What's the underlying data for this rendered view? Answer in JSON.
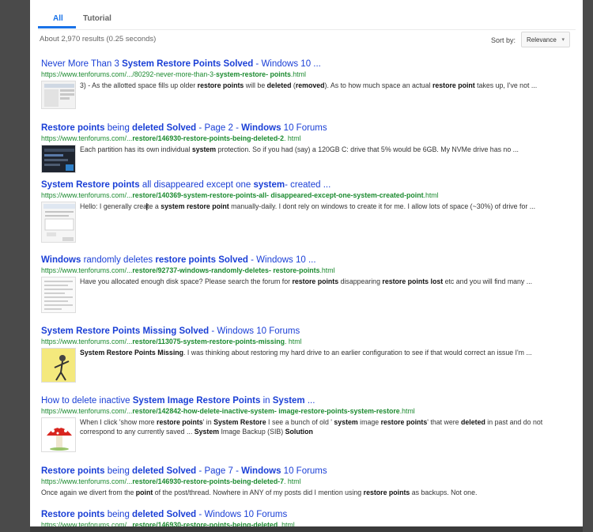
{
  "tabs": [
    {
      "label": "All",
      "active": true
    },
    {
      "label": "Tutorial",
      "active": false
    }
  ],
  "stats": "About 2,970 results (0.25 seconds)",
  "sort": {
    "label": "Sort by:",
    "value": "Relevance"
  },
  "results": [
    {
      "title_parts": [
        [
          "Never More Than 3 ",
          false
        ],
        [
          "System Restore Points Solved",
          true
        ],
        [
          " - Windows 10 ...",
          false
        ]
      ],
      "url_parts": [
        [
          "https://www.tenforums.com/.../80292-never-more-than-3-",
          false
        ],
        [
          "system-restore- points",
          true
        ],
        [
          ".html",
          false
        ]
      ],
      "snippet_parts": [
        [
          "3) - As the allotted space fills up older ",
          false
        ],
        [
          "restore points",
          true
        ],
        [
          " will be ",
          false
        ],
        [
          "deleted",
          true
        ],
        [
          " (",
          false
        ],
        [
          "removed",
          true
        ],
        [
          "). As to how much space an actual ",
          false
        ],
        [
          "restore point",
          true
        ],
        [
          " takes up, I've not ...",
          false
        ]
      ],
      "thumb": "screenshot-thumbnail"
    },
    {
      "title_parts": [
        [
          "Restore points",
          true
        ],
        [
          " being ",
          false
        ],
        [
          "deleted Solved",
          true
        ],
        [
          " - Page 2 - ",
          false
        ],
        [
          "Windows",
          true
        ],
        [
          " 10 Forums",
          false
        ]
      ],
      "url_parts": [
        [
          "https://www.tenforums.com/...",
          false
        ],
        [
          "restore",
          true
        ],
        [
          "/146930-restore-points-being-deleted-2",
          true
        ],
        [
          ". html",
          false
        ]
      ],
      "snippet_parts": [
        [
          "Each partition has its own individual ",
          false
        ],
        [
          "system",
          true
        ],
        [
          " protection. So if you had (say) a 120GB C: drive that 5% would be 6GB. My NVMe drive has no ...",
          false
        ]
      ],
      "thumb": "dark-screenshot-thumbnail"
    },
    {
      "title_parts": [
        [
          "System Restore points",
          true
        ],
        [
          " all disappeared except one ",
          false
        ],
        [
          "system",
          true
        ],
        [
          "- created ...",
          false
        ]
      ],
      "url_parts": [
        [
          "https://www.tenforums.com/...",
          false
        ],
        [
          "restore",
          true
        ],
        [
          "/140369-system-restore-points-all- disappeared-except-one-system-created-point",
          true
        ],
        [
          ".html",
          false
        ]
      ],
      "snippet_parts": [
        [
          "Hello: I generally create a ",
          false
        ],
        [
          "system restore point",
          true
        ],
        [
          " manually-daily. I dont rely on windows to create it for me. I allow lots of space (~30%) of drive for ...",
          false
        ]
      ],
      "thumb": "dialog-thumbnail"
    },
    {
      "title_parts": [
        [
          "Windows",
          true
        ],
        [
          " randomly deletes ",
          false
        ],
        [
          "restore points Solved",
          true
        ],
        [
          " - Windows 10 ...",
          false
        ]
      ],
      "url_parts": [
        [
          "https://www.tenforums.com/...",
          false
        ],
        [
          "restore",
          true
        ],
        [
          "/92737-windows-randomly-deletes- restore-points",
          true
        ],
        [
          ".html",
          false
        ]
      ],
      "snippet_parts": [
        [
          "Have you allocated enough disk space? Please search the forum for ",
          false
        ],
        [
          "restore points",
          true
        ],
        [
          " disappearing ",
          false
        ],
        [
          "restore points lost",
          true
        ],
        [
          " etc and you will find many ...",
          false
        ]
      ],
      "thumb": "list-thumbnail"
    },
    {
      "title_parts": [
        [
          "System Restore Points Missing Solved",
          true
        ],
        [
          " - Windows 10 Forums",
          false
        ]
      ],
      "url_parts": [
        [
          "https://www.tenforums.com/...",
          false
        ],
        [
          "restore",
          true
        ],
        [
          "/113075-system-restore-points-missing",
          true
        ],
        [
          ". html",
          false
        ]
      ],
      "snippet_parts": [
        [
          "System Restore Points Missing",
          true
        ],
        [
          ". I was thinking about restoring my hard drive to an earlier configuration to see if that would correct an issue I'm ...",
          false
        ]
      ],
      "thumb": "yellow-avatar-thumbnail"
    },
    {
      "title_parts": [
        [
          "How to delete inactive ",
          false
        ],
        [
          "System Image Restore Points",
          true
        ],
        [
          " in ",
          false
        ],
        [
          "System",
          true
        ],
        [
          " ...",
          false
        ]
      ],
      "url_parts": [
        [
          "https://www.tenforums.com/...",
          false
        ],
        [
          "restore",
          true
        ],
        [
          "/142842-how-delete-inactive-system- image-restore-points-system-restore",
          true
        ],
        [
          ".html",
          false
        ]
      ],
      "snippet_parts": [
        [
          "When I click 'show more ",
          false
        ],
        [
          "restore points",
          true
        ],
        [
          "' in ",
          false
        ],
        [
          "System Restore",
          true
        ],
        [
          " I see a bunch of old ' ",
          false
        ],
        [
          "system",
          true
        ],
        [
          " image ",
          false
        ],
        [
          "restore points",
          true
        ],
        [
          "' that were ",
          false
        ],
        [
          "deleted",
          true
        ],
        [
          " in past and do not correspond to any currently saved ... ",
          false
        ],
        [
          "System",
          true
        ],
        [
          " Image Backup (SIB) ",
          false
        ],
        [
          "Solution",
          true
        ]
      ],
      "thumb": "mushroom-thumbnail"
    },
    {
      "title_parts": [
        [
          "Restore points",
          true
        ],
        [
          " being ",
          false
        ],
        [
          "deleted Solved",
          true
        ],
        [
          " - Page 7 - ",
          false
        ],
        [
          "Windows",
          true
        ],
        [
          " 10 Forums",
          false
        ]
      ],
      "url_parts": [
        [
          "https://www.tenforums.com/...",
          false
        ],
        [
          "restore",
          true
        ],
        [
          "/146930-restore-points-being-deleted-7",
          true
        ],
        [
          ". html",
          false
        ]
      ],
      "snippet_parts": [
        [
          "Once again we divert from the ",
          false
        ],
        [
          "point",
          true
        ],
        [
          " of the post/thread. Nowhere in ANY of my posts did I mention using ",
          false
        ],
        [
          "restore points",
          true
        ],
        [
          " as backups. Not one.",
          false
        ]
      ],
      "thumb": ""
    },
    {
      "title_parts": [
        [
          "Restore points",
          true
        ],
        [
          " being ",
          false
        ],
        [
          "deleted Solved",
          true
        ],
        [
          " - Windows 10 Forums",
          false
        ]
      ],
      "url_parts": [
        [
          "https://www.tenforums.com/...",
          false
        ],
        [
          "restore",
          true
        ],
        [
          "/146930-restore-points-being-deleted",
          true
        ],
        [
          ". html",
          false
        ]
      ],
      "snippet_parts": [],
      "thumb": ""
    }
  ]
}
